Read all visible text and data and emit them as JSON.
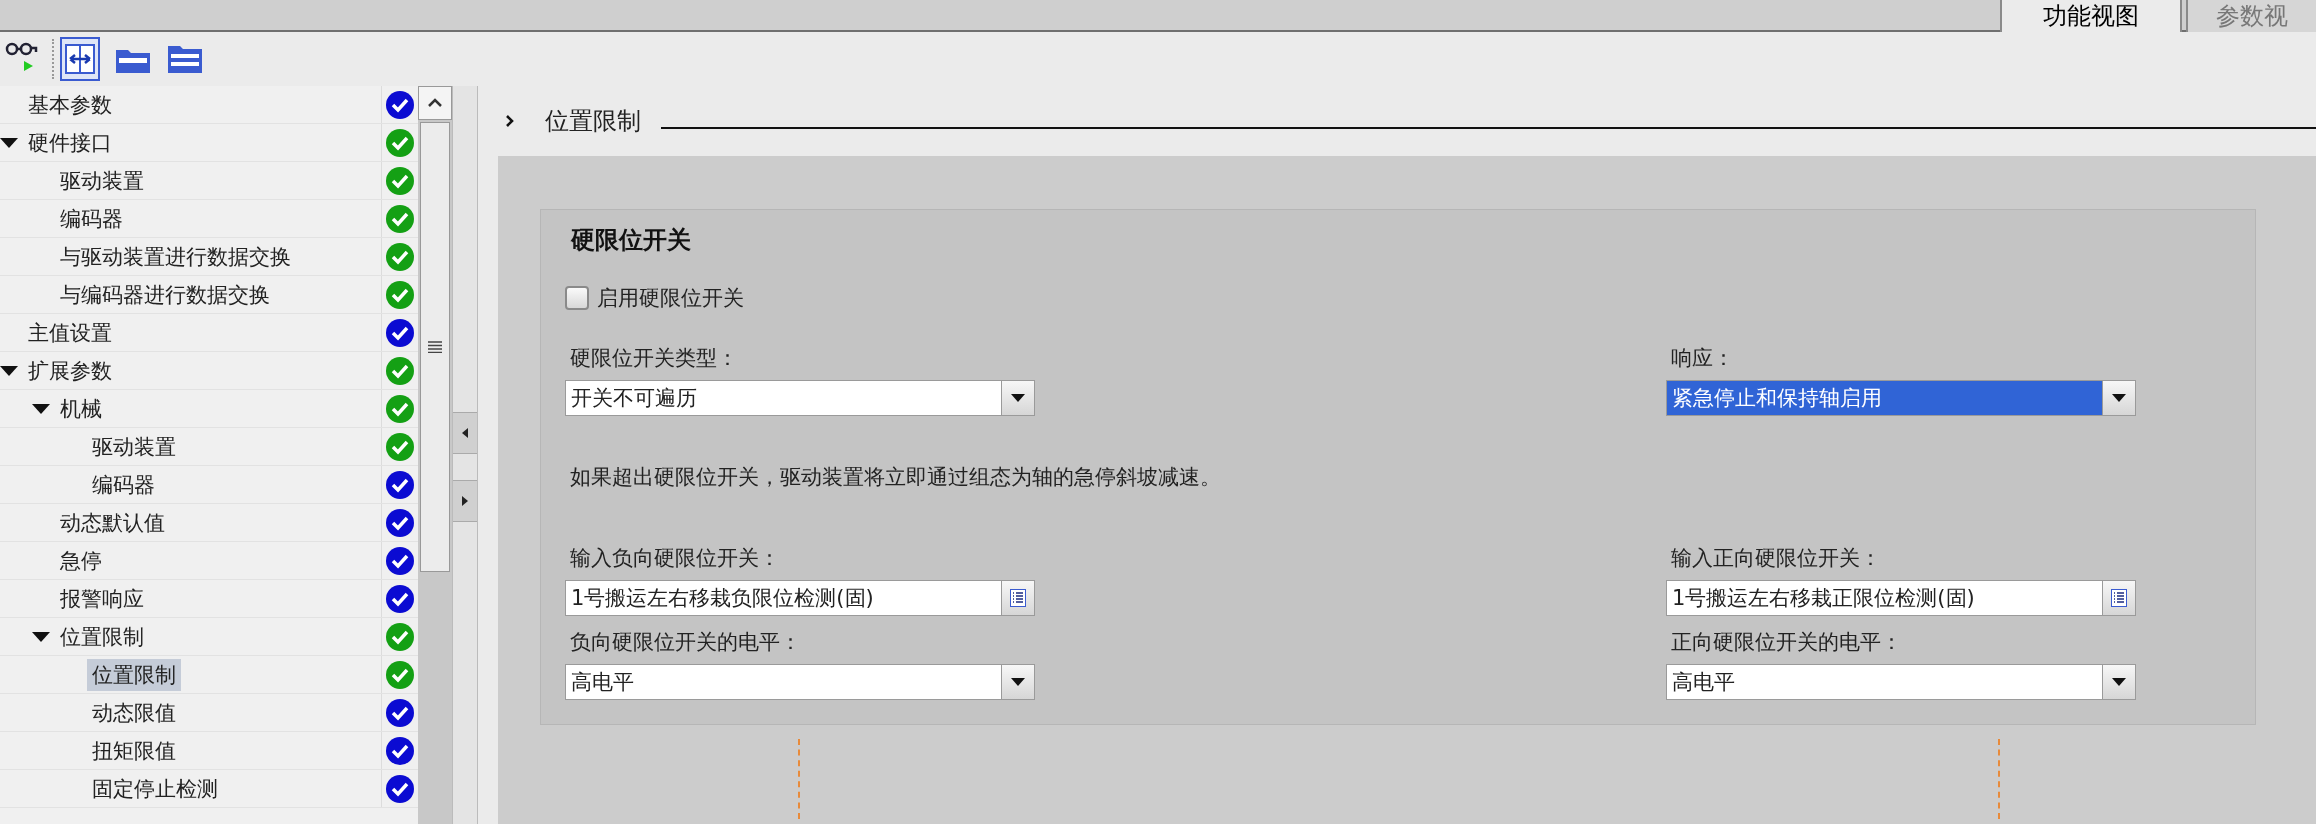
{
  "tabs": [
    {
      "label": "功能视图",
      "selected": true
    },
    {
      "label": "参数视",
      "selected": false
    }
  ],
  "tree": [
    {
      "label": "基本参数",
      "color": "#0b0bd2",
      "selected": false
    },
    {
      "label": "硬件接口",
      "color": "#14a014",
      "selected": false,
      "expanded": true,
      "children": [
        {
          "label": "驱动装置",
          "color": "#14a014",
          "selected": false
        },
        {
          "label": "编码器",
          "color": "#14a014",
          "selected": false
        },
        {
          "label": "与驱动装置进行数据交换",
          "color": "#14a014",
          "selected": false
        },
        {
          "label": "与编码器进行数据交换",
          "color": "#14a014",
          "selected": false
        }
      ]
    },
    {
      "label": "主值设置",
      "color": "#0b0bd2",
      "selected": false
    },
    {
      "label": "扩展参数",
      "color": "#14a014",
      "selected": false,
      "expanded": true,
      "children": [
        {
          "label": "机械",
          "color": "#14a014",
          "selected": false,
          "expanded": true,
          "children": [
            {
              "label": "驱动装置",
              "color": "#14a014",
              "selected": false
            },
            {
              "label": "编码器",
              "color": "#0b0bd2",
              "selected": false
            }
          ]
        },
        {
          "label": "动态默认值",
          "color": "#0b0bd2",
          "selected": false
        },
        {
          "label": "急停",
          "color": "#0b0bd2",
          "selected": false
        },
        {
          "label": "报警响应",
          "color": "#0b0bd2",
          "selected": false
        },
        {
          "label": "位置限制",
          "color": "#14a014",
          "selected": false,
          "expanded": true,
          "children": [
            {
              "label": "位置限制",
              "color": "#14a014",
              "selected": true
            },
            {
              "label": "动态限值",
              "color": "#0b0bd2",
              "selected": false
            },
            {
              "label": "扭矩限值",
              "color": "#0b0bd2",
              "selected": false
            },
            {
              "label": "固定停止检测",
              "color": "#0b0bd2",
              "selected": false
            }
          ]
        }
      ]
    }
  ],
  "section": {
    "title": "位置限制"
  },
  "group": {
    "title": "硬限位开关",
    "enable": {
      "label": "启用硬限位开关",
      "checked": false
    },
    "top_fields": [
      {
        "kind": "dropdown",
        "label": "硬限位开关类型：",
        "value": "开关不可遍历",
        "highlighted": false
      },
      {
        "kind": "dropdown",
        "label": "响应：",
        "value": "紧急停止和保持轴启用",
        "highlighted": true
      }
    ],
    "note": "如果超出硬限位开关，驱动装置将立即通过组态为轴的急停斜坡减速。",
    "bottom_fields": [
      {
        "kind": "input",
        "label": "输入负向硬限位开关：",
        "value": "1号搬运左右移栽负限位检测(固)"
      },
      {
        "kind": "input",
        "label": "输入正向硬限位开关：",
        "value": "1号搬运左右移栽正限位检测(固)"
      },
      {
        "kind": "dropdown",
        "label": "负向硬限位开关的电平：",
        "value": "高电平",
        "highlighted": false
      },
      {
        "kind": "dropdown",
        "label": "正向硬限位开关的电平：",
        "value": "高电平",
        "highlighted": false
      }
    ]
  }
}
